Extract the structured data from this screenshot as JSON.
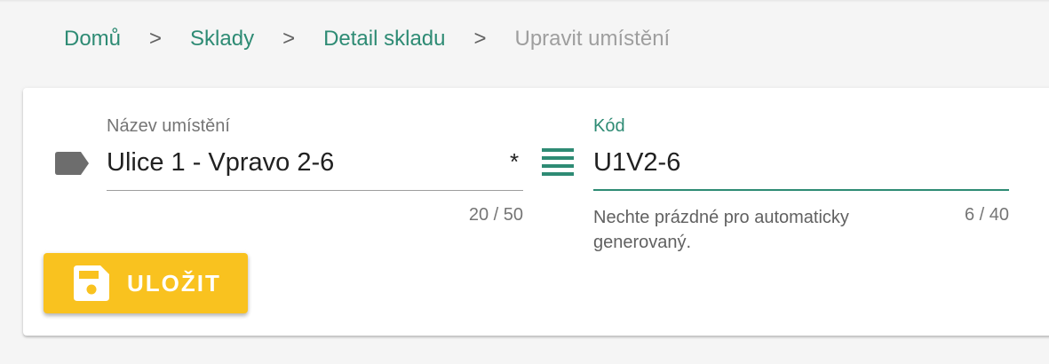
{
  "breadcrumb": {
    "items": [
      {
        "label": "Domů"
      },
      {
        "label": "Sklady"
      },
      {
        "label": "Detail skladu"
      }
    ],
    "separator": ">",
    "current": "Upravit umístění"
  },
  "form": {
    "name_field": {
      "label": "Název umístění",
      "value": "Ulice 1 - Vpravo 2-6",
      "required_mark": "*",
      "counter": "20 / 50",
      "icon": "label-icon"
    },
    "code_field": {
      "label": "Kód",
      "value": "U1V2-6",
      "hint": "Nechte prázdné pro automaticky generovaný.",
      "counter": "6 / 40",
      "icon": "list-icon"
    },
    "save_button": {
      "label": "ULOŽIT",
      "icon": "save-icon"
    }
  },
  "colors": {
    "accent": "#2e8b74",
    "button": "#f9c21f",
    "icon_gray": "#6d6d6d"
  }
}
